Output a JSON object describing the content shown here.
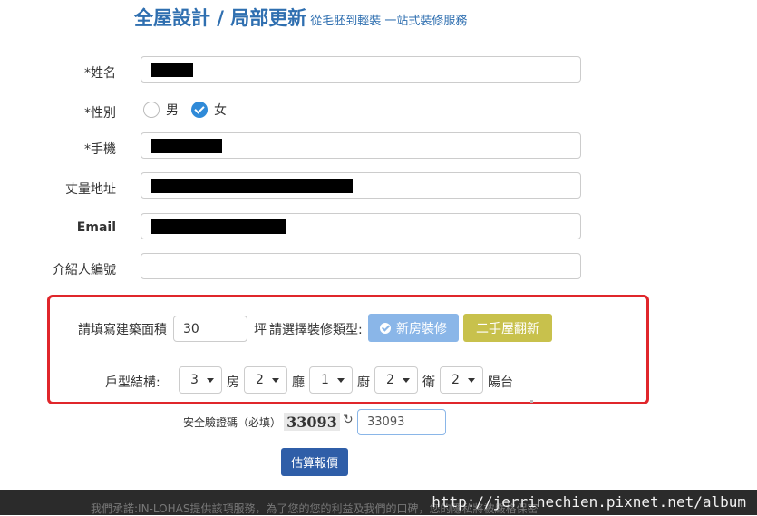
{
  "header": {
    "title": "全屋設計 / 局部更新",
    "subtitle": "從毛胚到輕裝 一站式裝修服務"
  },
  "form": {
    "name_label": "*姓名",
    "gender_label": "*性別",
    "gender_options": [
      "男",
      "女"
    ],
    "gender_selected": "女",
    "phone_label": "*手機",
    "address_label": "丈量地址",
    "email_label": "Email",
    "referrer_label": "介紹人編號"
  },
  "estimate": {
    "area_label": "請填寫建築面積",
    "area_value": "30",
    "area_unit": "坪",
    "type_label": "請選擇裝修類型:",
    "type_new_label": "新房裝修",
    "type_old_label": "二手屋翻新",
    "layout_label": "戶型結構:",
    "rooms": "3",
    "rooms_unit": "房",
    "halls": "2",
    "halls_unit": "廳",
    "kitchens": "1",
    "kitchens_unit": "廚",
    "baths": "2",
    "baths_unit": "衛",
    "balconies": "2",
    "balconies_unit": "陽台"
  },
  "captcha": {
    "label": "安全驗證碼（必填）",
    "code": "33093",
    "input_value": "33093"
  },
  "submit_label": "估算報價",
  "footer": {
    "text": "我們承諾:IN-LOHAS提供該項服務，為了您的您的利益及我們的口碑，您的隱私將被嚴格保密",
    "watermark": "http://jerrinechien.pixnet.net/album"
  }
}
